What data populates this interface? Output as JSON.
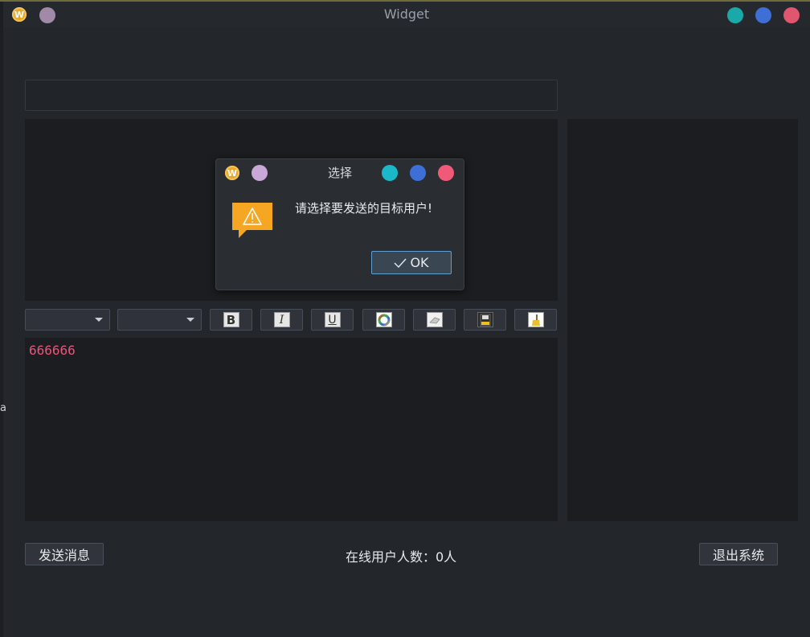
{
  "window": {
    "title": "Widget"
  },
  "editor": {
    "message_text": "666666"
  },
  "toolbar": {
    "bold_glyph": "B",
    "italic_glyph": "I",
    "underline_glyph": "U"
  },
  "footer": {
    "send_button": "发送消息",
    "online_label": "在线用户人数：0人",
    "exit_button": "退出系统"
  },
  "dialog": {
    "title": "选择",
    "message": "请选择要发送的目标用户!",
    "ok_button": "OK"
  },
  "colors": {
    "dot_purple": "#a08aa8",
    "dot_teal": "#1aa8a8",
    "dot_blue": "#3d6fd6",
    "dot_red": "#e0566e",
    "accent_text": "#e8557a"
  }
}
